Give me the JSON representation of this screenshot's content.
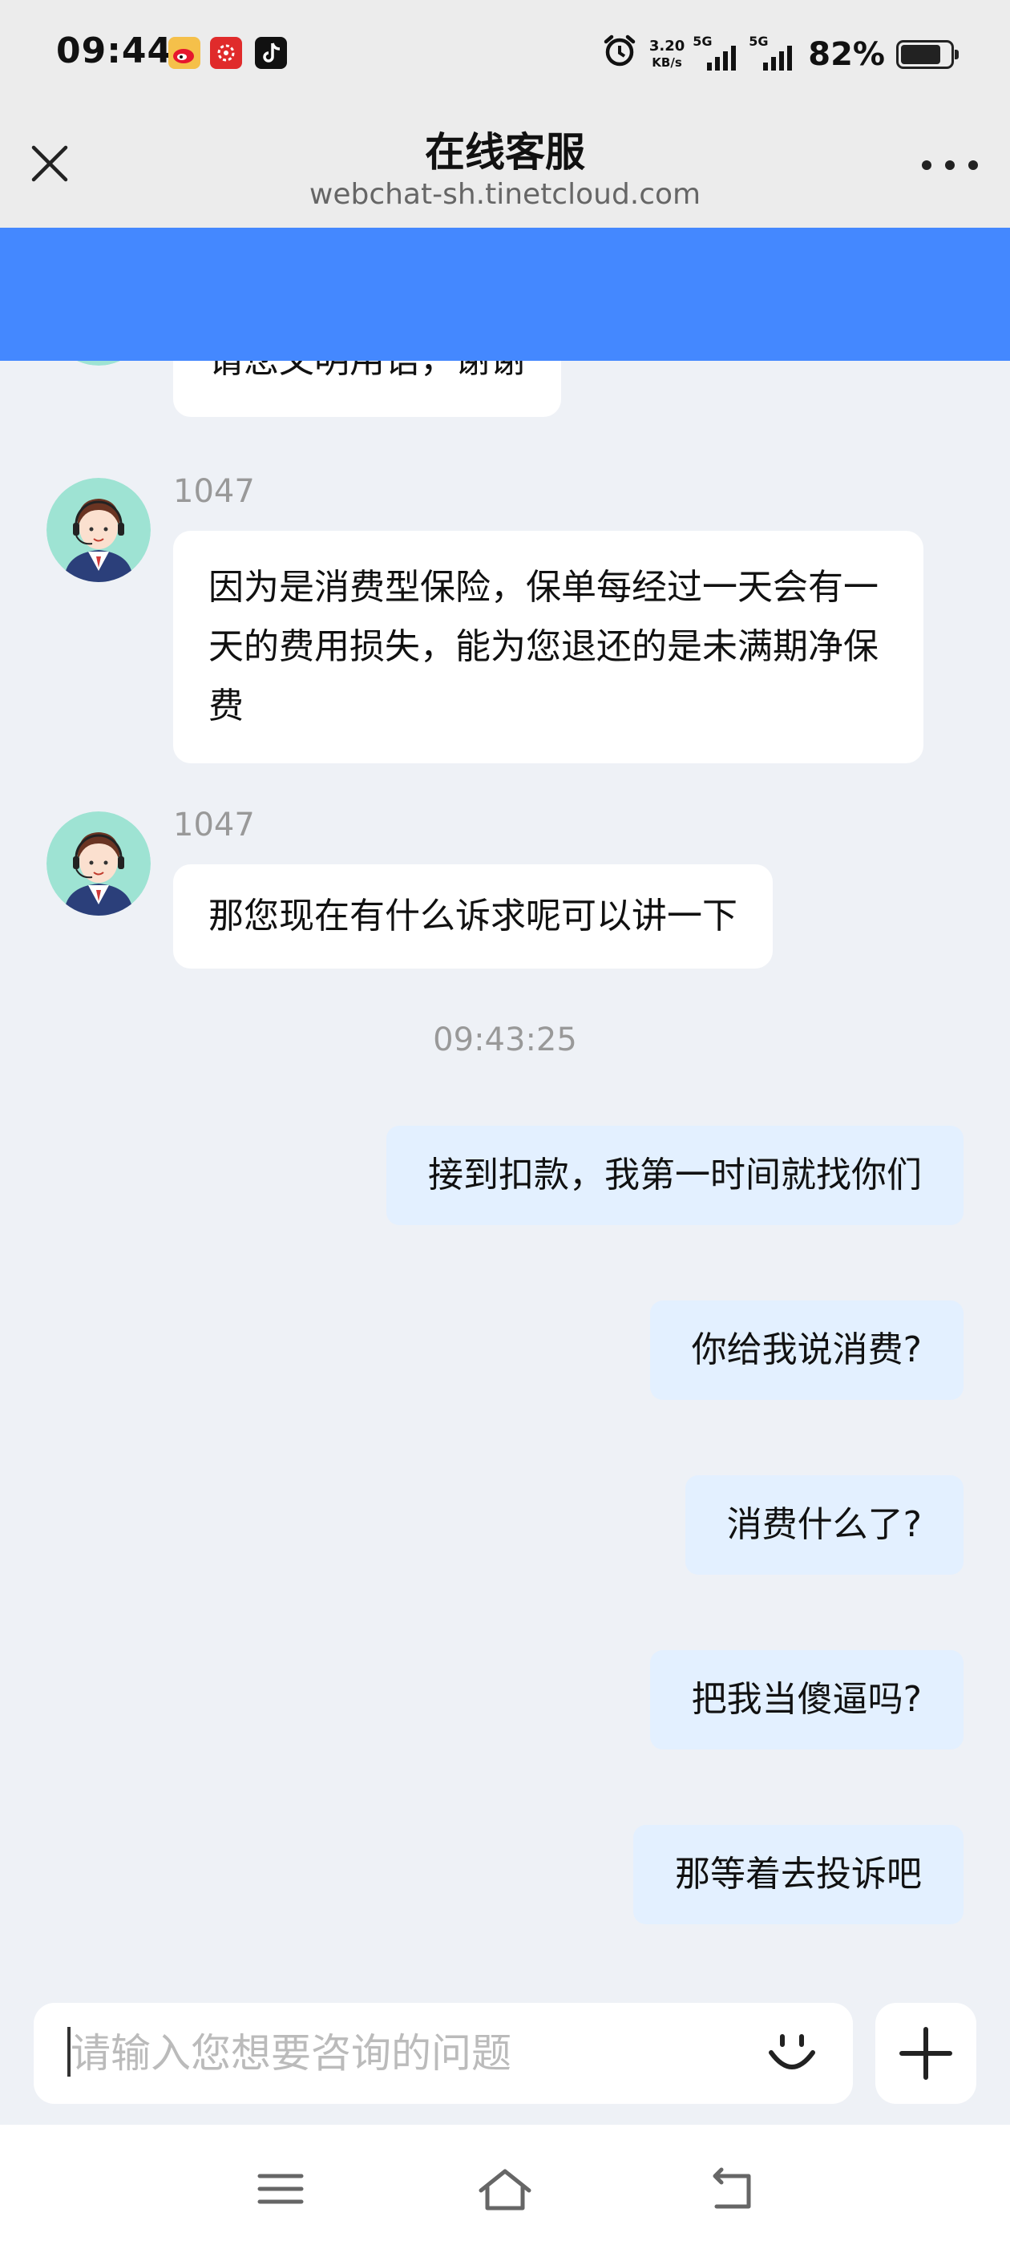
{
  "status_bar": {
    "time": "09:44",
    "net_speed_value": "3.20",
    "net_speed_unit": "KB/s",
    "signal1_label": "5G",
    "signal2_label": "5G",
    "battery_percent": "82%",
    "battery_level": 0.82,
    "notification_icons": [
      "weibo-icon",
      "app-red-icon",
      "tiktok-icon"
    ]
  },
  "header": {
    "title": "在线客服",
    "url": "webchat-sh.tinetcloud.com",
    "accent_color": "#4488ff"
  },
  "messages": [
    {
      "type": "agent",
      "sender": "",
      "text": "请您文明用语，谢谢"
    },
    {
      "type": "agent",
      "sender": "1047",
      "text": "因为是消费型保险，保单每经过一天会有一天的费用损失，能为您退还的是未满期净保费"
    },
    {
      "type": "agent",
      "sender": "1047",
      "text": "那您现在有什么诉求呢可以讲一下"
    },
    {
      "type": "timestamp",
      "text": "09:43:25"
    },
    {
      "type": "user",
      "text": "接到扣款，我第一时间就找你们"
    },
    {
      "type": "user",
      "text": "你给我说消费?"
    },
    {
      "type": "user",
      "text": "消费什么了?"
    },
    {
      "type": "user",
      "text": "把我当傻逼吗?"
    },
    {
      "type": "user",
      "text": "那等着去投诉吧"
    }
  ],
  "input": {
    "placeholder": "请输入您想要咨询的问题"
  }
}
